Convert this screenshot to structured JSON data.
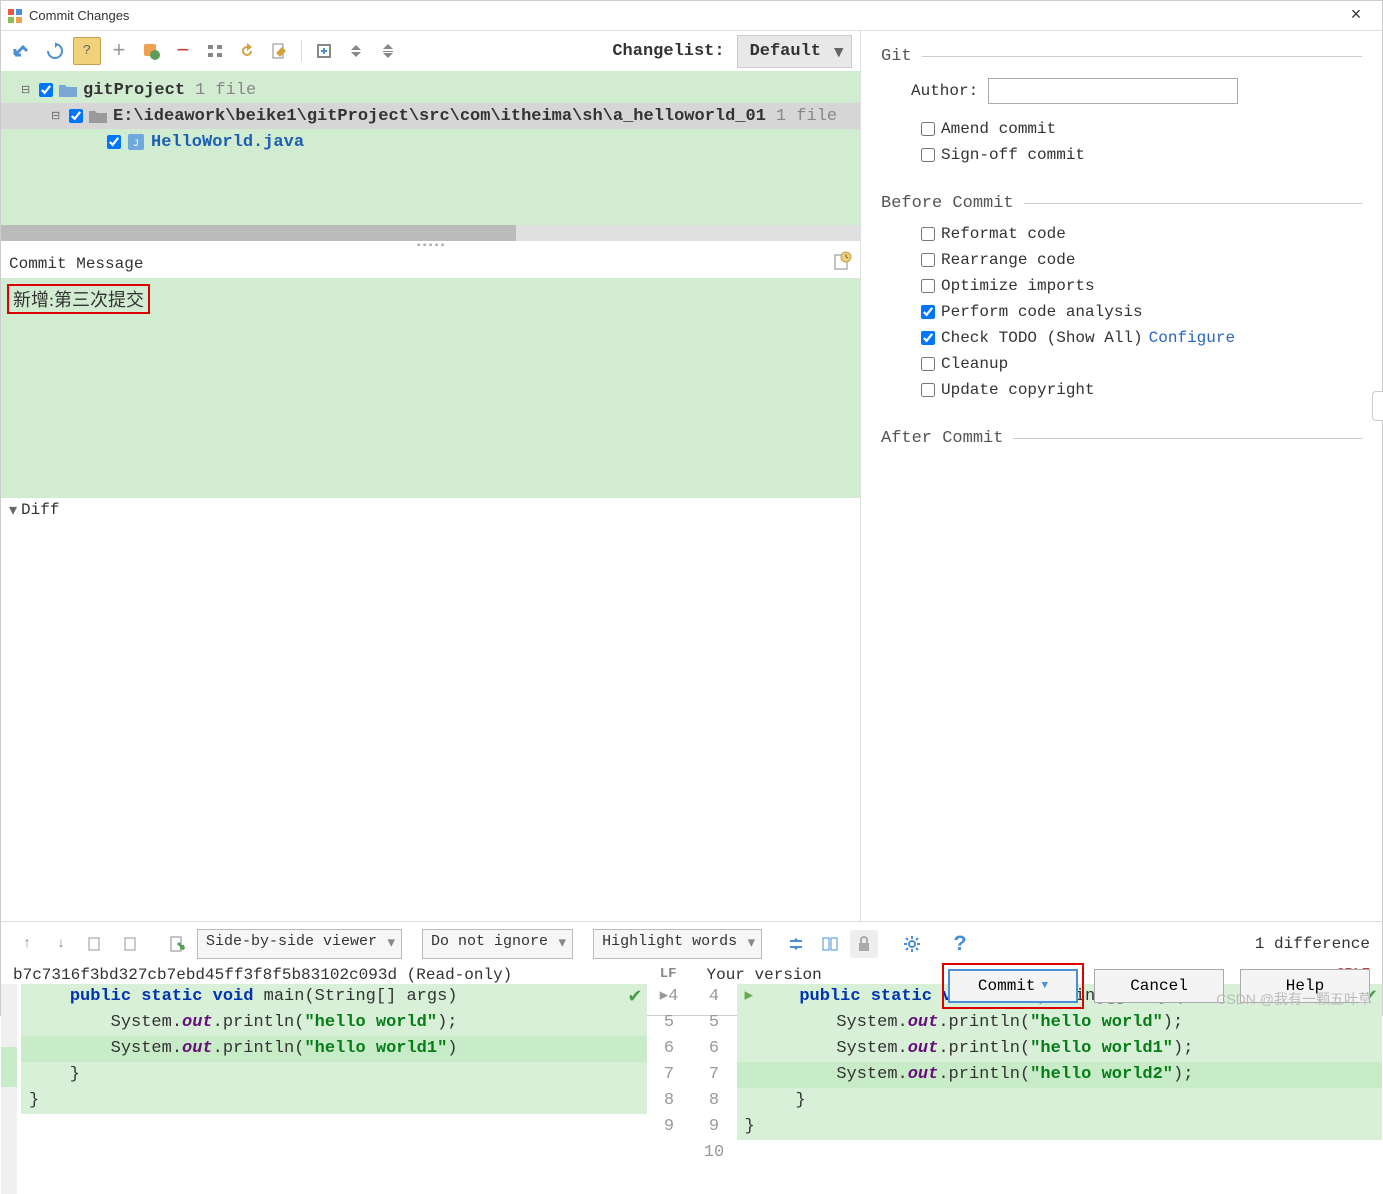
{
  "window": {
    "title": "Commit Changes"
  },
  "toolbar": {
    "changelist_label": "Changelist:",
    "changelist_value": "Default"
  },
  "tree": {
    "root": {
      "name": "gitProject",
      "meta": "1 file"
    },
    "dir": {
      "path": "E:\\ideawork\\beike1\\gitProject\\src\\com\\itheima\\sh\\a_helloworld_01",
      "meta": "1 file"
    },
    "file": {
      "name": "HelloWorld.java"
    }
  },
  "commit_message": {
    "label": "Commit Message",
    "text": "新增:第三次提交"
  },
  "right": {
    "git_title": "Git",
    "author_label": "Author:",
    "amend": "Amend commit",
    "signoff": "Sign-off commit",
    "before_title": "Before Commit",
    "reformat": "Reformat code",
    "rearrange": "Rearrange code",
    "optimize": "Optimize imports",
    "analysis": "Perform code analysis",
    "todo": "Check TODO (Show All)",
    "configure": "Configure",
    "cleanup": "Cleanup",
    "copyright": "Update copyright",
    "after_title": "After Commit"
  },
  "diff": {
    "header": "Diff",
    "viewer": "Side-by-side viewer",
    "ignore": "Do not ignore",
    "highlight": "Highlight words",
    "count": "1 difference",
    "left_label": "b7c7316f3bd327cb7ebd45ff3f8f5b83102c093d (Read-only)",
    "left_eol": "LF",
    "right_label": "Your version",
    "right_eol": "CRLF",
    "left_lines": [
      "4",
      "5",
      "6",
      "7",
      "8",
      "9"
    ],
    "right_lines": [
      "4",
      "5",
      "6",
      "7",
      "8",
      "9",
      "10"
    ]
  },
  "code": {
    "sig": "public static void main(String[] args)",
    "out1": "System.out.println(\"hello world\");",
    "out2_l": "System.out.println(\"hello world1\")",
    "out2_r": "System.out.println(\"hello world1\");",
    "out3": "System.out.println(\"hello world2\");"
  },
  "buttons": {
    "commit": "Commit",
    "cancel": "Cancel",
    "help": "Help"
  },
  "watermark": "CSDN @我有一颗五叶草"
}
